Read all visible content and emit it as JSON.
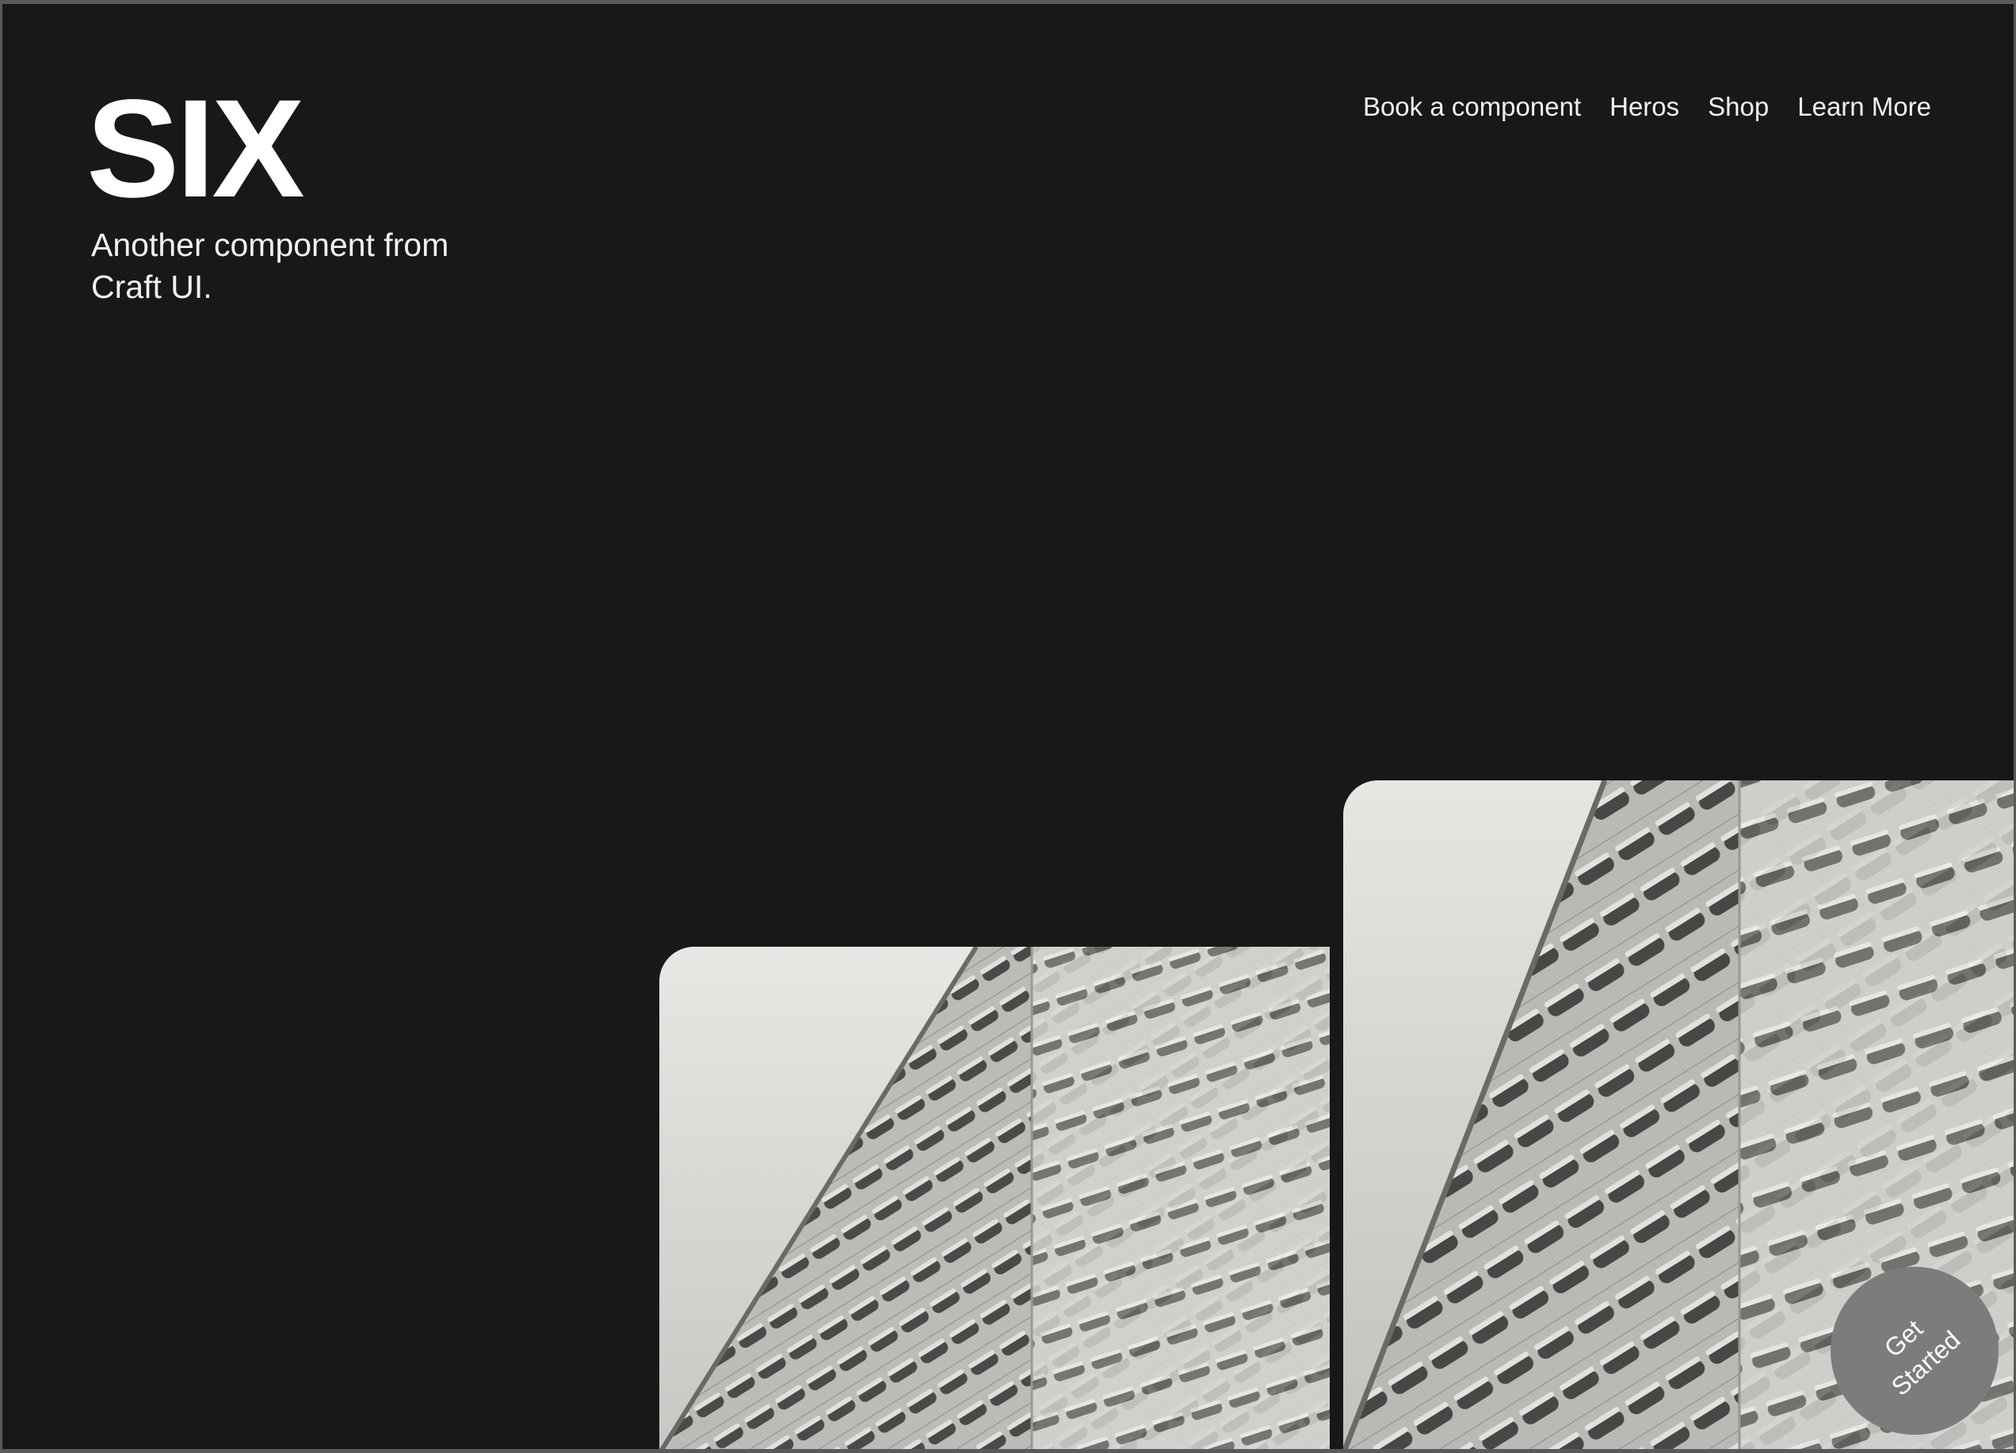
{
  "brand": {
    "title": "SIX",
    "subtitle": "Another component from Craft UI."
  },
  "nav": {
    "items": [
      {
        "label": "Book a component"
      },
      {
        "label": "Heros"
      },
      {
        "label": "Shop"
      },
      {
        "label": "Learn More"
      }
    ]
  },
  "gallery": {
    "images": [
      {
        "subject": "architectural concrete facade photo (monochrome)"
      },
      {
        "subject": "architectural concrete facade photo (monochrome)"
      }
    ]
  },
  "cta": {
    "label": "Get Started"
  },
  "colors": {
    "background": "#181818",
    "text": "#ffffff",
    "cta_background": "#7c7c7c"
  }
}
